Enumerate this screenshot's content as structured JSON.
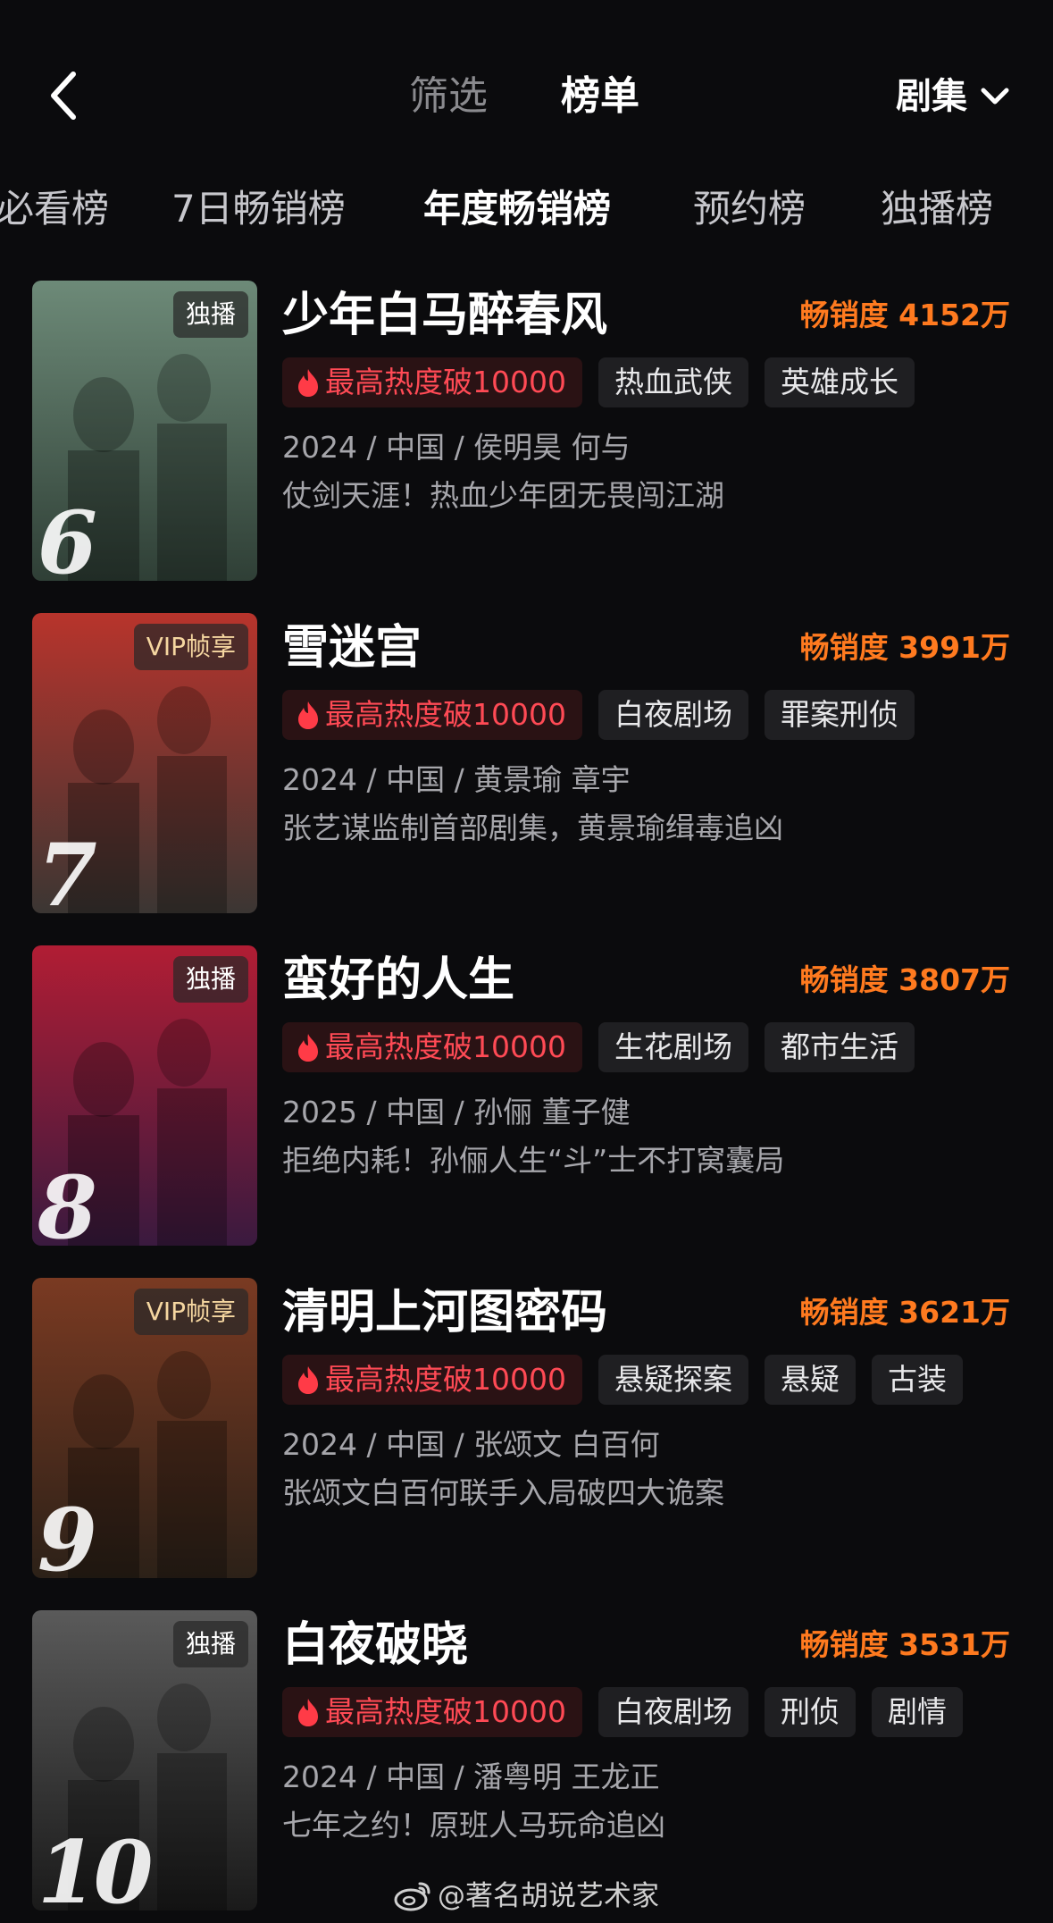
{
  "header": {
    "nav_tabs": [
      "筛选",
      "榜单"
    ],
    "category": "剧集"
  },
  "subtabs": [
    "必看榜",
    "7日畅销榜",
    "年度畅销榜",
    "预约榜",
    "独播榜"
  ],
  "active_subtab": "年度畅销榜",
  "items": [
    {
      "rank": "6",
      "badge": "独播",
      "title": "少年白马醉春风",
      "sales": "畅销度 4152万",
      "hot": "最高热度破10000",
      "tags": [
        "热血武侠",
        "英雄成长"
      ],
      "meta": "2024 / 中国 / 侯明昊 何与",
      "desc": "仗剑天涯！热血少年团无畏闯江湖",
      "poster_colors": [
        "#6d8a78",
        "#2f3f36"
      ]
    },
    {
      "rank": "7",
      "badge": "VIP帧享",
      "title": "雪迷宫",
      "sales": "畅销度 3991万",
      "hot": "最高热度破10000",
      "tags": [
        "白夜剧场",
        "罪案刑侦"
      ],
      "meta": "2024 / 中国 / 黄景瑜 章宇",
      "desc": "张艺谋监制首部剧集，黄景瑜缉毒追凶",
      "poster_colors": [
        "#b8342c",
        "#3b3633"
      ]
    },
    {
      "rank": "8",
      "badge": "独播",
      "title": "蛮好的人生",
      "sales": "畅销度 3807万",
      "hot": "最高热度破10000",
      "tags": [
        "生花剧场",
        "都市生活"
      ],
      "meta": "2025 / 中国 / 孙俪 董子健",
      "desc": "拒绝内耗！孙俪人生“斗”士不打窝囊局",
      "poster_colors": [
        "#b11d34",
        "#3a1a3f"
      ]
    },
    {
      "rank": "9",
      "badge": "VIP帧享",
      "title": "清明上河图密码",
      "sales": "畅销度 3621万",
      "hot": "最高热度破10000",
      "tags": [
        "悬疑探案",
        "悬疑",
        "古装"
      ],
      "meta": "2024 / 中国 / 张颂文 白百何",
      "desc": "张颂文白百何联手入局破四大诡案",
      "poster_colors": [
        "#7a3a22",
        "#2c2118"
      ]
    },
    {
      "rank": "10",
      "badge": "独播",
      "title": "白夜破晓",
      "sales": "畅销度 3531万",
      "hot": "最高热度破10000",
      "tags": [
        "白夜剧场",
        "刑侦",
        "剧情"
      ],
      "meta": "2024 / 中国 / 潘粤明 王龙正",
      "desc": "七年之约！原班人马玩命追凶",
      "poster_colors": [
        "#5a5a5a",
        "#1a1a1a"
      ]
    }
  ],
  "watermark": "@著名胡说艺术家",
  "colors": {
    "background": "#0b0b0d",
    "sales": "#ff7a1f",
    "hot": "#ff4a55"
  }
}
